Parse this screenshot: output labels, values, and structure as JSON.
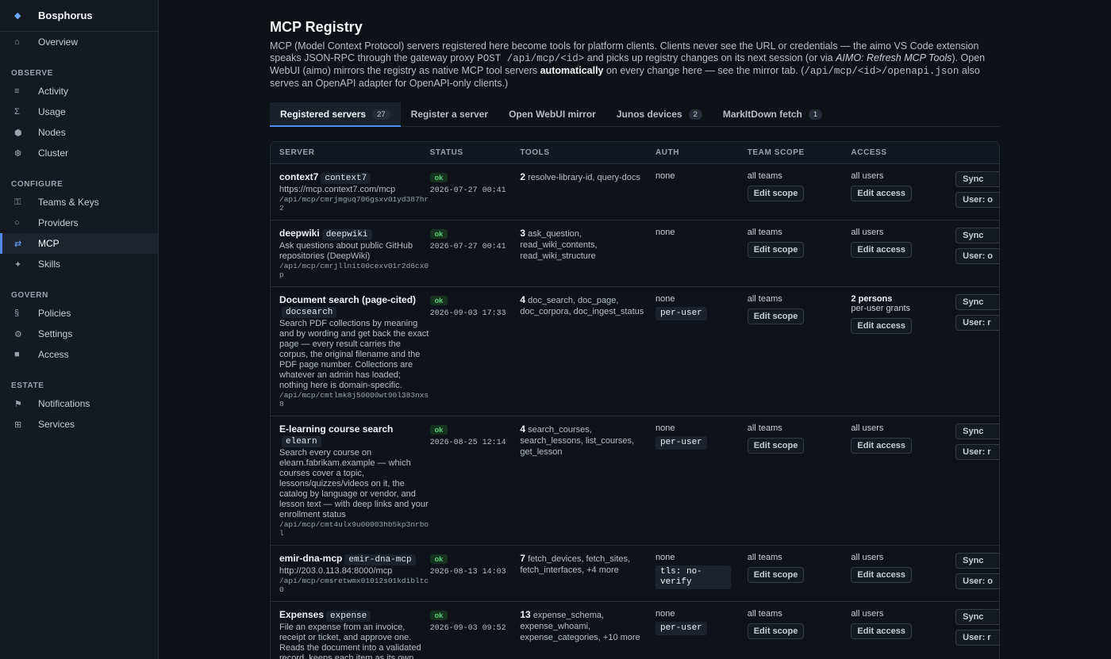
{
  "brand": {
    "name": "Bosphorus",
    "logo_icon": "diamond-icon"
  },
  "nav": {
    "overview": "Overview",
    "sections": [
      {
        "title": "OBSERVE",
        "items": [
          "Activity",
          "Usage",
          "Nodes",
          "Cluster"
        ]
      },
      {
        "title": "CONFIGURE",
        "items": [
          "Teams & Keys",
          "Providers",
          "MCP",
          "Skills"
        ]
      },
      {
        "title": "GOVERN",
        "items": [
          "Policies",
          "Settings",
          "Access"
        ]
      },
      {
        "title": "ESTATE",
        "items": [
          "Notifications",
          "Services"
        ]
      }
    ],
    "active": "MCP"
  },
  "page": {
    "title": "MCP Registry",
    "desc": {
      "p1": "MCP (Model Context Protocol) servers registered here become tools for platform clients. Clients never see the URL or credentials — the aimo VS Code extension speaks JSON-RPC through the gateway proxy ",
      "code1": "POST /api/mcp/<id>",
      "p2": " and picks up registry changes on its next session (or via ",
      "em1": "AIMO: Refresh MCP Tools",
      "p3": "). Open WebUI (aimo) mirrors the registry as native MCP tool servers ",
      "strong1": "automatically",
      "p4": " on every change here — see the mirror tab. (",
      "code2": "/api/mcp/<id>/openapi.json",
      "p5": " also serves an OpenAPI adapter for OpenAPI-only clients.)"
    }
  },
  "tabs": [
    {
      "label": "Registered servers",
      "count": "27"
    },
    {
      "label": "Register a server",
      "count": ""
    },
    {
      "label": "Open WebUI mirror",
      "count": ""
    },
    {
      "label": "Junos devices",
      "count": "2"
    },
    {
      "label": "MarkItDown fetch",
      "count": "1"
    }
  ],
  "table": {
    "headers": [
      "SERVER",
      "STATUS",
      "TOOLS",
      "AUTH",
      "TEAM SCOPE",
      "ACCESS"
    ],
    "edit_scope_label": "Edit scope",
    "edit_access_label": "Edit access",
    "sync_label": "Sync",
    "rows": [
      {
        "name": "context7",
        "slug": "context7",
        "desc": "https://mcp.context7.com/mcp",
        "path": "/api/mcp/cmrjmguq706gsxv01yd387hr2",
        "status": "ok",
        "ts": "2026-07-27 00:41",
        "tool_count": "2",
        "tools": "resolve-library-id, query-docs",
        "auth": "none",
        "auth_chip": "",
        "scope": "all teams",
        "access_strong": "",
        "access": "all users",
        "user_btn": "User: o"
      },
      {
        "name": "deepwiki",
        "slug": "deepwiki",
        "desc": "Ask questions about public GitHub repositories (DeepWiki)",
        "path": "/api/mcp/cmrjllnit00cexv01r2d6cx0p",
        "status": "ok",
        "ts": "2026-07-27 00:41",
        "tool_count": "3",
        "tools": "ask_question, read_wiki_contents, read_wiki_structure",
        "auth": "none",
        "auth_chip": "",
        "scope": "all teams",
        "access_strong": "",
        "access": "all users",
        "user_btn": "User: o"
      },
      {
        "name": "Document search (page-cited)",
        "slug": "docsearch",
        "desc": "Search PDF collections by meaning and by wording and get back the exact page — every result carries the corpus, the original filename and the PDF page number. Collections are whatever an admin has loaded; nothing here is domain-specific.",
        "path": "/api/mcp/cmtlmk8j50000wt90l383nxs8",
        "status": "ok",
        "ts": "2026-09-03 17:33",
        "tool_count": "4",
        "tools": "doc_search, doc_page, doc_corpora, doc_ingest_status",
        "auth": "none",
        "auth_chip": "per-user",
        "scope": "all teams",
        "access_strong": "2 persons",
        "access": "per-user grants",
        "user_btn": "User: r"
      },
      {
        "name": "E-learning course search",
        "slug": "elearn",
        "desc": "Search every course on elearn.fabrikam.example — which courses cover a topic, lessons/quizzes/videos on it, the catalog by language or vendor, and lesson text — with deep links and your enrollment status",
        "path": "/api/mcp/cmt4ulx9u00003hb5kp3nrbol",
        "status": "ok",
        "ts": "2026-08-25 12:14",
        "tool_count": "4",
        "tools": "search_courses, search_lessons, list_courses, get_lesson",
        "auth": "none",
        "auth_chip": "per-user",
        "scope": "all teams",
        "access_strong": "",
        "access": "all users",
        "user_btn": "User: r"
      },
      {
        "name": "emir-dna-mcp",
        "slug": "emir-dna-mcp",
        "desc": "http://203.0.113.84:8000/mcp",
        "path": "/api/mcp/cmsretwmx01012s01kdibltc0",
        "status": "ok",
        "ts": "2026-08-13 14:03",
        "tool_count": "7",
        "tools": "fetch_devices, fetch_sites, fetch_interfaces, +4 more",
        "auth": "none",
        "auth_chip": "tls: no-verify",
        "scope": "all teams",
        "access_strong": "",
        "access": "all users",
        "user_btn": "User: o"
      },
      {
        "name": "Expenses",
        "slug": "expense",
        "desc": "File an expense from an invoice, receipt or ticket, and approve one. Reads the document into a validated record, keeps each item as its own request with its own",
        "path": "",
        "status": "ok",
        "ts": "2026-09-03 09:52",
        "tool_count": "13",
        "tools": "expense_schema, expense_whoami, expense_categories, +10 more",
        "auth": "none",
        "auth_chip": "per-user",
        "scope": "all teams",
        "access_strong": "",
        "access": "all users",
        "user_btn": "User: r"
      }
    ]
  }
}
